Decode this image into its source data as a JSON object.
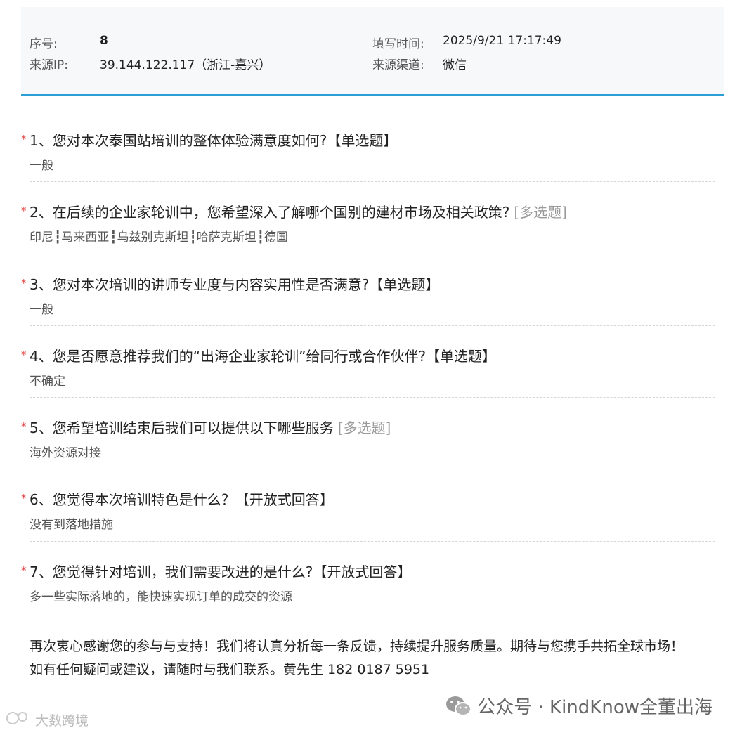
{
  "header": {
    "seq_label": "序号:",
    "seq_value": "8",
    "ip_label": "来源IP:",
    "ip_value": "39.144.122.117（浙江-嘉兴）",
    "time_label": "填写时间:",
    "time_value": "2025/9/21 17:17:49",
    "channel_label": "来源渠道:",
    "channel_value": "微信"
  },
  "questions": [
    {
      "title": "1、您对本次泰国站培训的整体体验满意度如何?【单选题】",
      "type_tag": "",
      "answer": "一般"
    },
    {
      "title": "2、在后续的企业家轮训中，您希望深入了解哪个国别的建材市场及相关政策?",
      "type_tag": "[多选题]",
      "answers": [
        "印尼",
        "马来西亚",
        "乌兹别克斯坦",
        "哈萨克斯坦",
        "德国"
      ]
    },
    {
      "title": "3、您对本次培训的讲师专业度与内容实用性是否满意?【单选题】",
      "type_tag": "",
      "answer": "一般"
    },
    {
      "title": "4、您是否愿意推荐我们的“出海企业家轮训”给同行或合作伙伴?【单选题】",
      "type_tag": "",
      "answer": "不确定"
    },
    {
      "title": "5、您希望培训结束后我们可以提供以下哪些服务",
      "type_tag": "[多选题]",
      "answer": "海外资源对接"
    },
    {
      "title": "6、您觉得本次培训特色是什么？【开放式回答】",
      "type_tag": "",
      "answer": "没有到落地措施"
    },
    {
      "title": "7、您觉得针对培训，我们需要改进的是什么?【开放式回答】",
      "type_tag": "",
      "answer": "多一些实际落地的，能快速实现订单的成交的资源"
    }
  ],
  "closing": {
    "line1": "再次衷心感谢您的参与与支持！我们将认真分析每一条反馈，持续提升服务质量。期待与您携手共拓全球市场！",
    "line2": "如有任何疑问或建议，请随时与我们联系。黄先生 182 0187 5951"
  },
  "watermark": {
    "right_text": "公众号 · KindKnow全董出海",
    "left_text": "大数跨境"
  },
  "colors": {
    "accent": "#2a9fd6",
    "required": "#e4393c"
  }
}
